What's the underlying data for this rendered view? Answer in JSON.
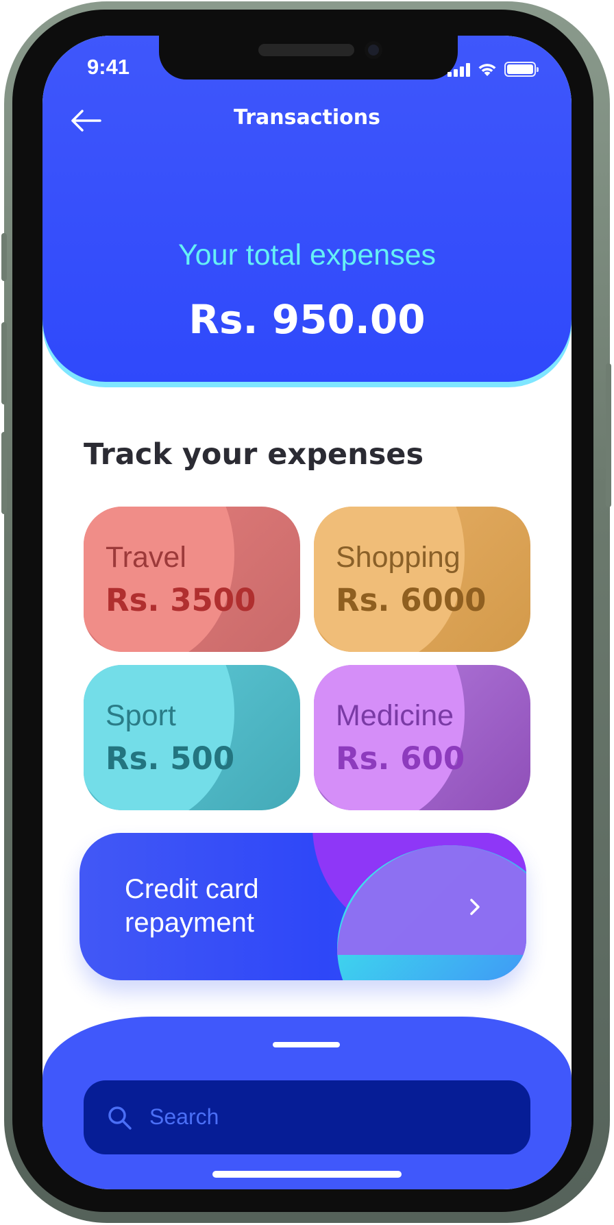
{
  "status_bar": {
    "time": "9:41"
  },
  "nav": {
    "title": "Transactions"
  },
  "summary": {
    "label": "Your total expenses",
    "amount": "Rs. 950.00"
  },
  "section": {
    "title": "Track your expenses"
  },
  "categories": [
    {
      "label": "Travel",
      "amount": "Rs. 3500"
    },
    {
      "label": "Shopping",
      "amount": "Rs. 6000"
    },
    {
      "label": "Sport",
      "amount": "Rs. 500"
    },
    {
      "label": "Medicine",
      "amount": "Rs. 600"
    }
  ],
  "repayment": {
    "label": "Credit card repayment"
  },
  "search": {
    "placeholder": "Search"
  },
  "icons": {
    "back": "arrow-left-icon",
    "chevron": "chevron-right-icon",
    "search": "search-icon",
    "signal": "cellular-signal-icon",
    "wifi": "wifi-icon",
    "battery": "battery-icon"
  },
  "colors": {
    "primary": "#3f57fb",
    "accent_cyan": "#66f0f5",
    "travel": "#e47e7c",
    "shopping": "#e8b068",
    "sport": "#5fcbd8",
    "medicine": "#b67ee0",
    "search_bg": "#061d96"
  }
}
